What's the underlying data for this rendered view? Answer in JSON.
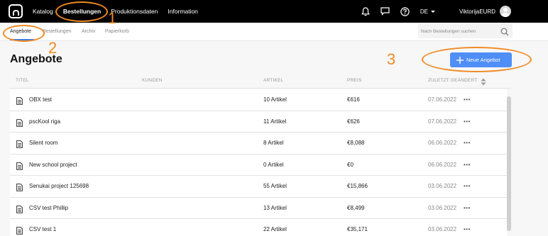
{
  "topbar": {
    "nav": [
      "Katalog",
      "Bestellungen",
      "Produktionsdaten",
      "Information"
    ],
    "language": "DE",
    "user": "ViktorijaEURD"
  },
  "subnav": {
    "tabs": [
      "Angebote",
      "Bestellungen",
      "Archiv",
      "Papierkorb"
    ],
    "search_placeholder": "Nach Bestellungen suchen"
  },
  "page": {
    "title": "Angebote",
    "new_button": "Neue Angebot"
  },
  "table": {
    "columns": [
      "TITEL",
      "KUNDEN",
      "ARTIKEL",
      "PREIS",
      "ZULETZT GEÄNDERT"
    ],
    "rows": [
      {
        "title": "OBX test",
        "articles": "10 Artikel",
        "price": "€616",
        "date": "07.06.2022"
      },
      {
        "title": "pscKool riga",
        "articles": "11 Artikel",
        "price": "€626",
        "date": "07.06.2022"
      },
      {
        "title": "Silent room",
        "articles": "8 Artikel",
        "price": "€8,088",
        "date": "06.06.2022"
      },
      {
        "title": "New school project",
        "articles": "0 Artikel",
        "price": "€0",
        "date": "06.06.2022"
      },
      {
        "title": "Senukai project 125698",
        "articles": "55 Artikel",
        "price": "€15,866",
        "date": "03.06.2022"
      },
      {
        "title": "CSV test Phillip",
        "articles": "13 Artikel",
        "price": "€8,499",
        "date": "03.06.2022"
      },
      {
        "title": "CSV test 1",
        "articles": "22 Artikel",
        "price": "€35,171",
        "date": "03.06.2022"
      }
    ],
    "more_label": "•••"
  },
  "annotations": [
    "1",
    "2",
    "3"
  ],
  "colors": {
    "accent": "#4f8ef7",
    "annotation": "#f08a24",
    "topbar": "#000000"
  }
}
